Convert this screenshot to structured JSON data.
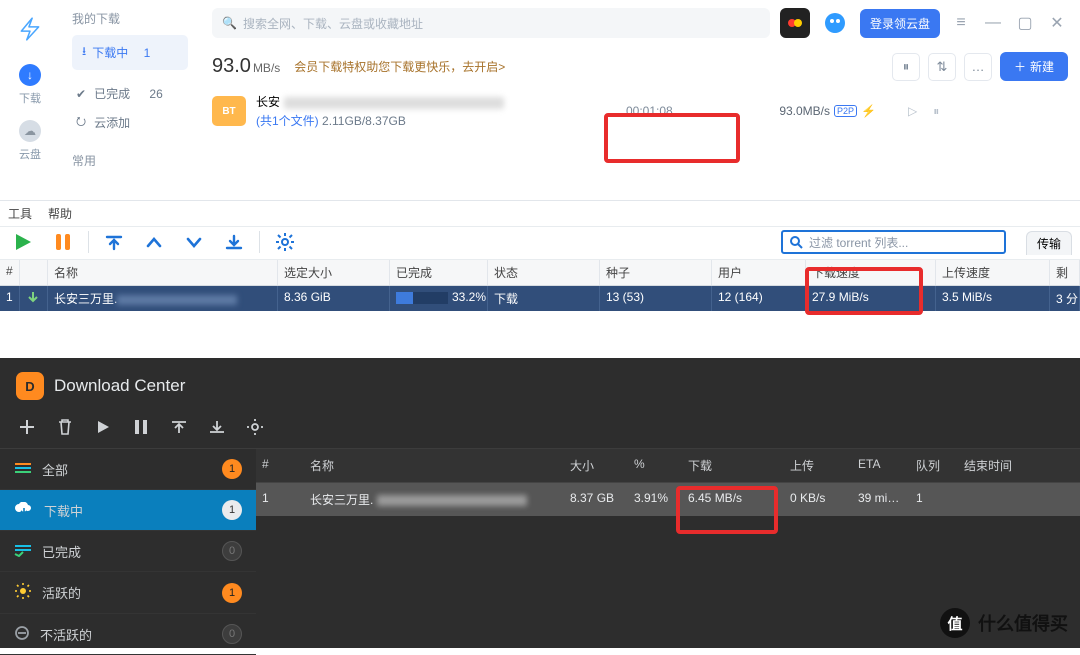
{
  "xunlei": {
    "side_header": "我的下载",
    "items": {
      "downloading": {
        "label": "下载中",
        "count": "1"
      },
      "finished": {
        "label": "已完成",
        "count": "26"
      },
      "cloud": {
        "label": "云添加"
      }
    },
    "recent_label": "常用",
    "rail": {
      "download": "下载",
      "cloud": "云盘"
    },
    "search_placeholder": "搜索全网、下载、云盘或收藏地址",
    "login_button": "登录领云盘",
    "speed_value": "93.0",
    "speed_unit": "MB/s",
    "vip_hint": "会员下载特权助您下载更快乐，去开启>",
    "new_button": "新建",
    "task": {
      "folder_badge": "BT",
      "name_prefix": "长安",
      "files_link_prefix": "(共1个文件)",
      "size_progress": "2.11GB/8.37GB",
      "elapsed": "00:01:08",
      "rate": "93.0MB/s",
      "p2p": "P2P"
    }
  },
  "qb": {
    "menu": {
      "tools": "工具",
      "help": "帮助"
    },
    "filter_placeholder": "过滤 torrent 列表...",
    "tab": "传输",
    "columns": {
      "hash": "#",
      "name": "名称",
      "size": "选定大小",
      "done": "已完成",
      "status": "状态",
      "seeds": "种子",
      "peers": "用户",
      "dl": "下载速度",
      "ul": "上传速度",
      "remain": "剩"
    },
    "row": {
      "hash": "1",
      "name_prefix": "长安三万里.",
      "size": "8.36 GiB",
      "done_pct": "33.2%",
      "done_fill": "33.2",
      "status": "下载",
      "seeds": "13 (53)",
      "peers": "12 (164)",
      "dl": "27.9 MiB/s",
      "ul": "3.5 MiB/s",
      "remain": "3 分"
    }
  },
  "dc": {
    "title": "Download Center",
    "side": {
      "all": {
        "label": "全部",
        "badge": "1"
      },
      "dl": {
        "label": "下载中",
        "badge": "1"
      },
      "done": {
        "label": "已完成",
        "badge": "0"
      },
      "active": {
        "label": "活跃的",
        "badge": "1"
      },
      "inactive": {
        "label": "不活跃的",
        "badge": "0"
      }
    },
    "columns": {
      "num": "#",
      "name": "名称",
      "size": "大小",
      "pct": "%",
      "dl": "下载",
      "ul": "上传",
      "eta": "ETA",
      "queue": "队列",
      "end": "结束时间"
    },
    "row": {
      "num": "1",
      "name_prefix": "长安三万里.",
      "size": "8.37 GB",
      "pct": "3.91%",
      "dl": "6.45 MB/s",
      "ul": "0 KB/s",
      "eta": "39 mi…",
      "queue": "1"
    }
  },
  "watermark": "什么值得买",
  "watermark_badge": "值"
}
